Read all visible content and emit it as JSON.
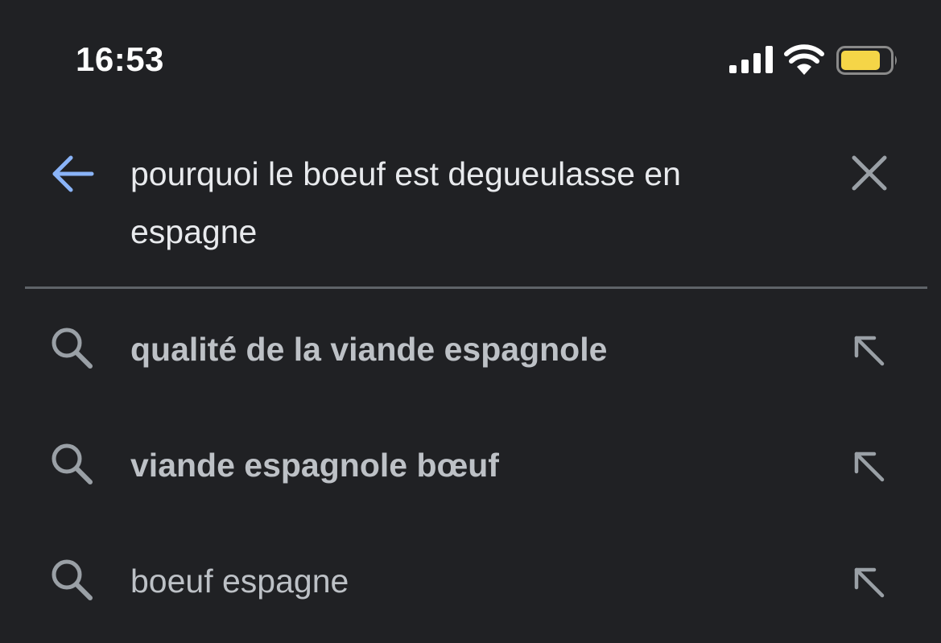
{
  "status_bar": {
    "time": "16:53",
    "icons": [
      "signal-icon",
      "wifi-icon",
      "battery-icon"
    ],
    "battery_color": "#f5d547"
  },
  "search": {
    "query": "pourquoi le boeuf est degueulasse en espagne",
    "back_icon": "arrow-left-icon",
    "clear_icon": "close-icon",
    "accent_color": "#8ab4f8"
  },
  "suggestions": [
    {
      "text": "qualité de la viande espagnole",
      "bold": true,
      "icon": "search-icon",
      "fill_icon": "arrow-up-left-icon"
    },
    {
      "text": "viande espagnole bœuf",
      "bold": true,
      "icon": "search-icon",
      "fill_icon": "arrow-up-left-icon"
    },
    {
      "text": "boeuf espagne",
      "bold": false,
      "icon": "search-icon",
      "fill_icon": "arrow-up-left-icon"
    }
  ]
}
